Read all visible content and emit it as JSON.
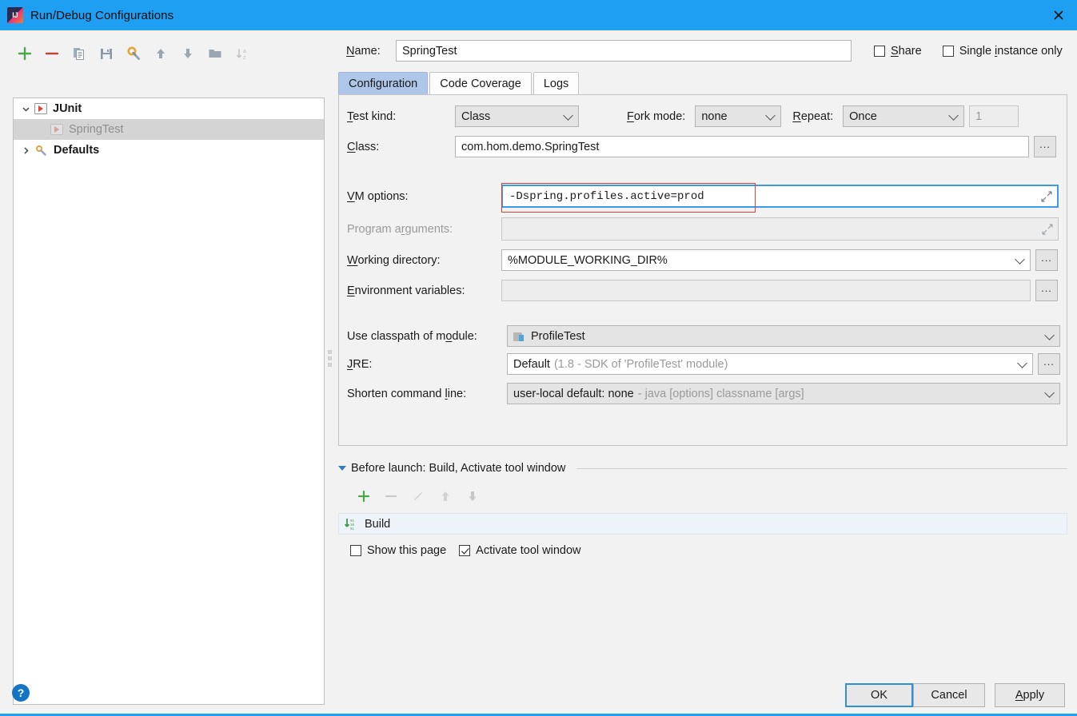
{
  "window": {
    "title": "Run/Debug Configurations",
    "logo_icon": "intellij-idea-logo-icon",
    "close_icon": "close-icon"
  },
  "left_panel": {
    "toolbar": [
      {
        "name": "add",
        "icon": "plus-icon",
        "tooltip": "Add New Configuration",
        "enabled": true
      },
      {
        "name": "remove",
        "icon": "minus-icon",
        "tooltip": "Remove Configuration",
        "enabled": true
      },
      {
        "name": "copy",
        "icon": "copy-icon",
        "tooltip": "Copy Configuration",
        "enabled": true
      },
      {
        "name": "save",
        "icon": "save-icon",
        "tooltip": "Save Configuration",
        "enabled": true
      },
      {
        "name": "edit-defaults",
        "icon": "wrench-gear-icon",
        "tooltip": "Edit defaults",
        "enabled": true
      },
      {
        "name": "move-up",
        "icon": "arrow-up-icon",
        "tooltip": "Move Up",
        "enabled": true
      },
      {
        "name": "move-down",
        "icon": "arrow-down-icon",
        "tooltip": "Move Down",
        "enabled": true
      },
      {
        "name": "new-folder",
        "icon": "folder-icon",
        "tooltip": "Create New Folder",
        "enabled": true
      },
      {
        "name": "sort",
        "icon": "sort-alphabetically-icon",
        "tooltip": "Sort Configurations",
        "enabled": false
      }
    ],
    "tree": [
      {
        "label": "JUnit",
        "icon": "junit-run-icon",
        "level": 0,
        "expanded": true,
        "selected": false,
        "bold": true
      },
      {
        "label": "SpringTest",
        "icon": "junit-run-icon",
        "level": 1,
        "expanded": null,
        "selected": true,
        "bold": false
      },
      {
        "label": "Defaults",
        "icon": "wrench-gear-icon",
        "level": 0,
        "expanded": false,
        "selected": false,
        "bold": true
      }
    ]
  },
  "form": {
    "name_label": "Name:",
    "name_value": "SpringTest",
    "share": {
      "label": "Share",
      "checked": false
    },
    "single_instance": {
      "label": "Single instance only",
      "checked": false
    },
    "tabs": [
      {
        "label": "Configuration",
        "active": true
      },
      {
        "label": "Code Coverage",
        "active": false
      },
      {
        "label": "Logs",
        "active": false
      }
    ],
    "test_kind": {
      "label": "Test kind:",
      "value": "Class"
    },
    "fork_mode": {
      "label": "Fork mode:",
      "value": "none"
    },
    "repeat": {
      "label": "Repeat:",
      "value": "Once",
      "count": "1"
    },
    "class": {
      "label": "Class:",
      "value": "com.hom.demo.SpringTest",
      "browse": "..."
    },
    "vm_options": {
      "label": "VM options:",
      "value": "-Dspring.profiles.active=prod",
      "expand_icon": "expand-icon",
      "highlighted": true
    },
    "program_arguments": {
      "label": "Program arguments:",
      "value": "",
      "expand_icon": "expand-icon",
      "disabled": true
    },
    "working_directory": {
      "label": "Working directory:",
      "value": "%MODULE_WORKING_DIR%",
      "browse": "..."
    },
    "environment_variables": {
      "label": "Environment variables:",
      "value": "",
      "browse": "..."
    },
    "use_classpath_of_module": {
      "label": "Use classpath of module:",
      "value": "ProfileTest",
      "icon": "module-icon"
    },
    "jre": {
      "label": "JRE:",
      "value": "Default",
      "value_hint": "(1.8 - SDK of 'ProfileTest' module)",
      "browse": "..."
    },
    "shorten_command_line": {
      "label": "Shorten command line:",
      "value": "user-local default: none",
      "value_hint": "- java [options] classname [args]"
    }
  },
  "before_launch": {
    "title": "Before launch: Build, Activate tool window",
    "toolbar": [
      {
        "name": "add-task",
        "icon": "plus-icon",
        "enabled": true
      },
      {
        "name": "remove-task",
        "icon": "minus-icon",
        "enabled": false
      },
      {
        "name": "edit-task",
        "icon": "pencil-icon",
        "enabled": false
      },
      {
        "name": "task-move-up",
        "icon": "arrow-up-icon",
        "enabled": false
      },
      {
        "name": "task-move-down",
        "icon": "arrow-down-icon",
        "enabled": false
      }
    ],
    "tasks": [
      {
        "label": "Build",
        "icon": "build-compile-icon"
      }
    ],
    "show_this_page": {
      "label": "Show this page",
      "checked": false
    },
    "activate_tool_window": {
      "label": "Activate tool window",
      "checked": true
    }
  },
  "footer": {
    "help_icon": "help-question-icon",
    "ok": "OK",
    "cancel": "Cancel",
    "apply": "Apply"
  },
  "colors": {
    "titlebar": "#1e9ff2",
    "accent": "#1e9ff2",
    "tab_active": "#aec6e8",
    "highlight_box": "#d8403a",
    "focus_border": "#3d9ae8",
    "panel_bg": "#f2f2f2"
  }
}
